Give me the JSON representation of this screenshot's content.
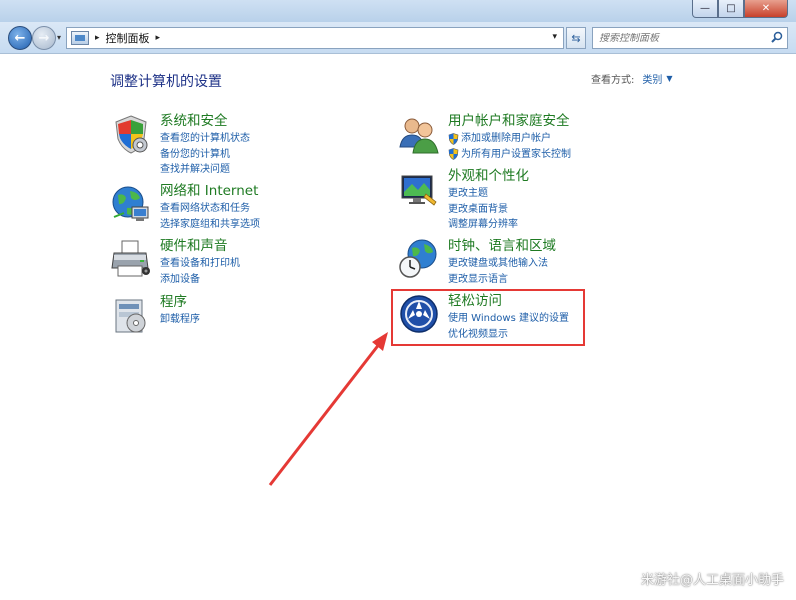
{
  "window": {
    "min_glyph": "—",
    "max_glyph": "□",
    "close_glyph": "✕"
  },
  "nav": {
    "back_glyph": "←",
    "forward_glyph": "→",
    "dropdown_glyph": "▾",
    "refresh_glyph": "⇆"
  },
  "address": {
    "separator1": "▸",
    "path": "控制面板",
    "separator2": "▸",
    "dropdown_glyph": "▾"
  },
  "search": {
    "placeholder": "搜索控制面板"
  },
  "main": {
    "title": "调整计算机的设置",
    "view_by_label": "查看方式:",
    "view_by_value": "类别",
    "view_by_caret": "▼"
  },
  "categories": [
    {
      "title": "系统和安全",
      "links": [
        "查看您的计算机状态",
        "备份您的计算机",
        "查找并解决问题"
      ],
      "icon": "shield-security-icon"
    },
    {
      "title": "网络和 Internet",
      "links": [
        "查看网络状态和任务",
        "选择家庭组和共享选项"
      ],
      "icon": "network-globe-icon"
    },
    {
      "title": "硬件和声音",
      "links": [
        "查看设备和打印机",
        "添加设备"
      ],
      "icon": "printer-icon"
    },
    {
      "title": "程序",
      "links": [
        "卸载程序"
      ],
      "icon": "programs-icon"
    },
    {
      "title": "用户帐户和家庭安全",
      "links": [
        "添加或删除用户帐户",
        "为所有用户设置家长控制"
      ],
      "icon": "users-icon"
    },
    {
      "title": "外观和个性化",
      "links": [
        "更改主题",
        "更改桌面背景",
        "调整屏幕分辨率"
      ],
      "icon": "appearance-monitor-icon"
    },
    {
      "title": "时钟、语言和区域",
      "links": [
        "更改键盘或其他输入法",
        "更改显示语言"
      ],
      "icon": "clock-globe-icon"
    },
    {
      "title": "轻松访问",
      "links": [
        "使用 Windows 建议的设置",
        "优化视频显示"
      ],
      "icon": "ease-of-access-icon"
    }
  ],
  "annotation": {
    "box_color": "#e53935",
    "arrow_color": "#e53935"
  },
  "watermark": "米游社@人工桌面小助手",
  "colors": {
    "category_title": "#1e7a22",
    "link": "#1e5ea8",
    "page_title": "#1e3287"
  }
}
